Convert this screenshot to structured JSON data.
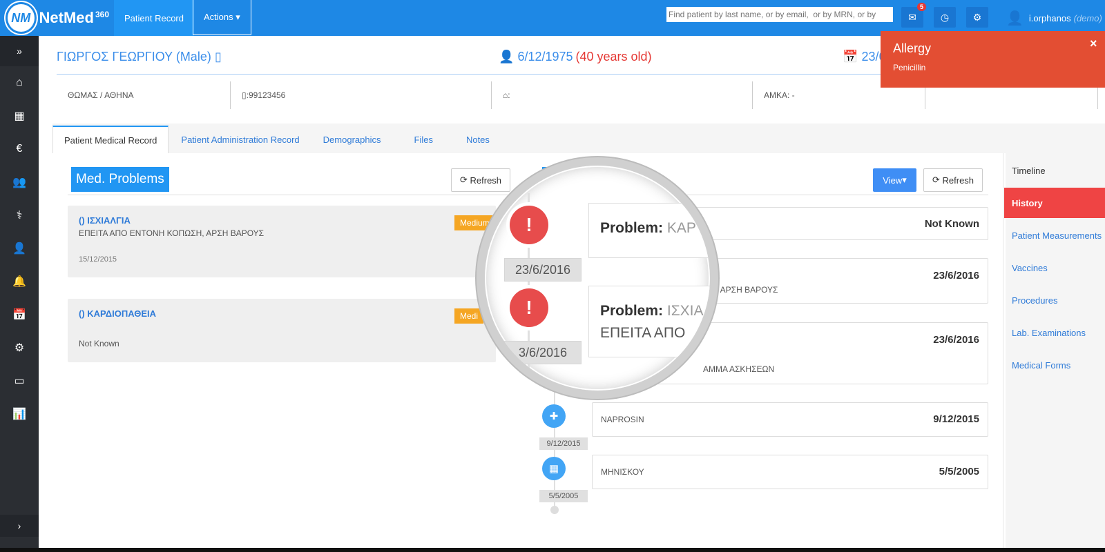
{
  "topbar": {
    "logo_initials": "NM",
    "logo_text": "NetMed",
    "logo_sup": "360",
    "nav_patient_record": "Patient Record",
    "nav_actions": "Actions ▾",
    "search_placeholder": "Find patient by last name, or by email,  or by MRN, or by",
    "messages_badge": "5",
    "user_name": "i.orphanos",
    "user_role": "(demo)",
    "colors": {
      "bar": "#1e88e5",
      "active": "#2196f3"
    }
  },
  "sidebar": {
    "icons": [
      "expand-icon",
      "home-icon",
      "calendar-icon",
      "euro-icon",
      "users-icon",
      "doctor-icon",
      "user-icon",
      "bell-icon",
      "calendar-alt-icon",
      "cogs-icon",
      "card-icon",
      "bar-chart-icon"
    ],
    "glyphs": [
      "»",
      "⌂",
      "▦",
      "€",
      "👥",
      "⚕",
      "👤",
      "🔔",
      "📅",
      "⚙",
      "▭",
      "📊"
    ],
    "collapse_glyph": "›"
  },
  "patient": {
    "name": "ΓΙΩΡΓΟΣ ΓΕΩΡΓΙΟΥ (Male)",
    "dob": "6/12/1975",
    "age": "(40 years old)",
    "date": "23/6",
    "location": "ΘΩΜΑΣ / ΑΘΗΝΑ",
    "phone": "99123456",
    "address": ":",
    "amka": "ΑΜΚΑ: -"
  },
  "tabs": [
    {
      "label": "Patient Medical Record",
      "active": true
    },
    {
      "label": "Patient Administration Record",
      "active": false
    },
    {
      "label": "Demographics",
      "active": false
    },
    {
      "label": "Files",
      "active": false
    },
    {
      "label": "Notes",
      "active": false
    }
  ],
  "med_problems": {
    "title": "Med. Problems",
    "refresh_label": "Refresh",
    "items": [
      {
        "name": "() ΙΣΧΙΑΛΓΙΑ",
        "desc": "ΕΠΕΙΤΑ ΑΠΟ ΕΝΤΟΝΗ ΚΟΠΩΣΗ, ΑΡΣΗ ΒΑΡΟΥΣ",
        "date": "15/12/2015",
        "severity": "Medium"
      },
      {
        "name": "() ΚΑΡΔΙΟΠΑΘΕΙΑ",
        "desc": "",
        "date": "Not Known",
        "severity": "Medi"
      }
    ]
  },
  "timeline": {
    "view_label": "View",
    "refresh_label": "Refresh",
    "entries": [
      {
        "text": "",
        "date": "Not Known"
      },
      {
        "text": "Η, ΑΡΣΗ ΒΑΡΟΥΣ",
        "date": "23/6/2016"
      },
      {
        "text": "ΑΜΜΑ ΑΣΚΗΣΕΩΝ",
        "date": "23/6/2016"
      },
      {
        "text": "NAPROSIN",
        "date": "9/12/2015",
        "label_date": "9/12/2015"
      },
      {
        "text": "ΜΗΝΙΣΚΟΥ",
        "date": "5/5/2005",
        "label_date": "5/5/2005"
      }
    ]
  },
  "magnifier": {
    "date1": "23/6/2016",
    "date2": "3/6/2016",
    "problem_label": "Problem:",
    "problem1": "ΚΑΡ",
    "problem2": "ΙΣΧΙΑ",
    "problem2_sub": "ΕΠΕΙΤΑ ΑΠΟ"
  },
  "right_menu": {
    "title": "Timeline",
    "history": "History",
    "items": [
      "Patient Measurements",
      "Vaccines",
      "Procedures",
      "Lab. Examinations",
      "Medical Forms"
    ]
  },
  "allergy": {
    "title": "Allergy",
    "item": "Penicillin",
    "close": "×",
    "color": "#e34e33"
  }
}
